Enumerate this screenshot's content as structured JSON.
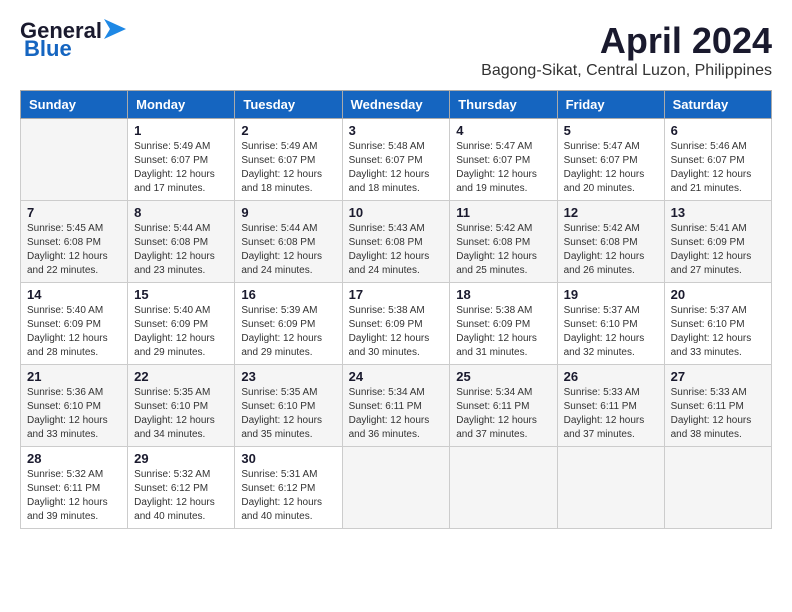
{
  "header": {
    "logo_general": "General",
    "logo_blue": "Blue",
    "month_title": "April 2024",
    "location": "Bagong-Sikat, Central Luzon, Philippines"
  },
  "weekdays": [
    "Sunday",
    "Monday",
    "Tuesday",
    "Wednesday",
    "Thursday",
    "Friday",
    "Saturday"
  ],
  "weeks": [
    [
      {
        "day": "",
        "sunrise": "",
        "sunset": "",
        "daylight": ""
      },
      {
        "day": "1",
        "sunrise": "Sunrise: 5:49 AM",
        "sunset": "Sunset: 6:07 PM",
        "daylight": "Daylight: 12 hours and 17 minutes."
      },
      {
        "day": "2",
        "sunrise": "Sunrise: 5:49 AM",
        "sunset": "Sunset: 6:07 PM",
        "daylight": "Daylight: 12 hours and 18 minutes."
      },
      {
        "day": "3",
        "sunrise": "Sunrise: 5:48 AM",
        "sunset": "Sunset: 6:07 PM",
        "daylight": "Daylight: 12 hours and 18 minutes."
      },
      {
        "day": "4",
        "sunrise": "Sunrise: 5:47 AM",
        "sunset": "Sunset: 6:07 PM",
        "daylight": "Daylight: 12 hours and 19 minutes."
      },
      {
        "day": "5",
        "sunrise": "Sunrise: 5:47 AM",
        "sunset": "Sunset: 6:07 PM",
        "daylight": "Daylight: 12 hours and 20 minutes."
      },
      {
        "day": "6",
        "sunrise": "Sunrise: 5:46 AM",
        "sunset": "Sunset: 6:07 PM",
        "daylight": "Daylight: 12 hours and 21 minutes."
      }
    ],
    [
      {
        "day": "7",
        "sunrise": "Sunrise: 5:45 AM",
        "sunset": "Sunset: 6:08 PM",
        "daylight": "Daylight: 12 hours and 22 minutes."
      },
      {
        "day": "8",
        "sunrise": "Sunrise: 5:44 AM",
        "sunset": "Sunset: 6:08 PM",
        "daylight": "Daylight: 12 hours and 23 minutes."
      },
      {
        "day": "9",
        "sunrise": "Sunrise: 5:44 AM",
        "sunset": "Sunset: 6:08 PM",
        "daylight": "Daylight: 12 hours and 24 minutes."
      },
      {
        "day": "10",
        "sunrise": "Sunrise: 5:43 AM",
        "sunset": "Sunset: 6:08 PM",
        "daylight": "Daylight: 12 hours and 24 minutes."
      },
      {
        "day": "11",
        "sunrise": "Sunrise: 5:42 AM",
        "sunset": "Sunset: 6:08 PM",
        "daylight": "Daylight: 12 hours and 25 minutes."
      },
      {
        "day": "12",
        "sunrise": "Sunrise: 5:42 AM",
        "sunset": "Sunset: 6:08 PM",
        "daylight": "Daylight: 12 hours and 26 minutes."
      },
      {
        "day": "13",
        "sunrise": "Sunrise: 5:41 AM",
        "sunset": "Sunset: 6:09 PM",
        "daylight": "Daylight: 12 hours and 27 minutes."
      }
    ],
    [
      {
        "day": "14",
        "sunrise": "Sunrise: 5:40 AM",
        "sunset": "Sunset: 6:09 PM",
        "daylight": "Daylight: 12 hours and 28 minutes."
      },
      {
        "day": "15",
        "sunrise": "Sunrise: 5:40 AM",
        "sunset": "Sunset: 6:09 PM",
        "daylight": "Daylight: 12 hours and 29 minutes."
      },
      {
        "day": "16",
        "sunrise": "Sunrise: 5:39 AM",
        "sunset": "Sunset: 6:09 PM",
        "daylight": "Daylight: 12 hours and 29 minutes."
      },
      {
        "day": "17",
        "sunrise": "Sunrise: 5:38 AM",
        "sunset": "Sunset: 6:09 PM",
        "daylight": "Daylight: 12 hours and 30 minutes."
      },
      {
        "day": "18",
        "sunrise": "Sunrise: 5:38 AM",
        "sunset": "Sunset: 6:09 PM",
        "daylight": "Daylight: 12 hours and 31 minutes."
      },
      {
        "day": "19",
        "sunrise": "Sunrise: 5:37 AM",
        "sunset": "Sunset: 6:10 PM",
        "daylight": "Daylight: 12 hours and 32 minutes."
      },
      {
        "day": "20",
        "sunrise": "Sunrise: 5:37 AM",
        "sunset": "Sunset: 6:10 PM",
        "daylight": "Daylight: 12 hours and 33 minutes."
      }
    ],
    [
      {
        "day": "21",
        "sunrise": "Sunrise: 5:36 AM",
        "sunset": "Sunset: 6:10 PM",
        "daylight": "Daylight: 12 hours and 33 minutes."
      },
      {
        "day": "22",
        "sunrise": "Sunrise: 5:35 AM",
        "sunset": "Sunset: 6:10 PM",
        "daylight": "Daylight: 12 hours and 34 minutes."
      },
      {
        "day": "23",
        "sunrise": "Sunrise: 5:35 AM",
        "sunset": "Sunset: 6:10 PM",
        "daylight": "Daylight: 12 hours and 35 minutes."
      },
      {
        "day": "24",
        "sunrise": "Sunrise: 5:34 AM",
        "sunset": "Sunset: 6:11 PM",
        "daylight": "Daylight: 12 hours and 36 minutes."
      },
      {
        "day": "25",
        "sunrise": "Sunrise: 5:34 AM",
        "sunset": "Sunset: 6:11 PM",
        "daylight": "Daylight: 12 hours and 37 minutes."
      },
      {
        "day": "26",
        "sunrise": "Sunrise: 5:33 AM",
        "sunset": "Sunset: 6:11 PM",
        "daylight": "Daylight: 12 hours and 37 minutes."
      },
      {
        "day": "27",
        "sunrise": "Sunrise: 5:33 AM",
        "sunset": "Sunset: 6:11 PM",
        "daylight": "Daylight: 12 hours and 38 minutes."
      }
    ],
    [
      {
        "day": "28",
        "sunrise": "Sunrise: 5:32 AM",
        "sunset": "Sunset: 6:11 PM",
        "daylight": "Daylight: 12 hours and 39 minutes."
      },
      {
        "day": "29",
        "sunrise": "Sunrise: 5:32 AM",
        "sunset": "Sunset: 6:12 PM",
        "daylight": "Daylight: 12 hours and 40 minutes."
      },
      {
        "day": "30",
        "sunrise": "Sunrise: 5:31 AM",
        "sunset": "Sunset: 6:12 PM",
        "daylight": "Daylight: 12 hours and 40 minutes."
      },
      {
        "day": "",
        "sunrise": "",
        "sunset": "",
        "daylight": ""
      },
      {
        "day": "",
        "sunrise": "",
        "sunset": "",
        "daylight": ""
      },
      {
        "day": "",
        "sunrise": "",
        "sunset": "",
        "daylight": ""
      },
      {
        "day": "",
        "sunrise": "",
        "sunset": "",
        "daylight": ""
      }
    ]
  ]
}
